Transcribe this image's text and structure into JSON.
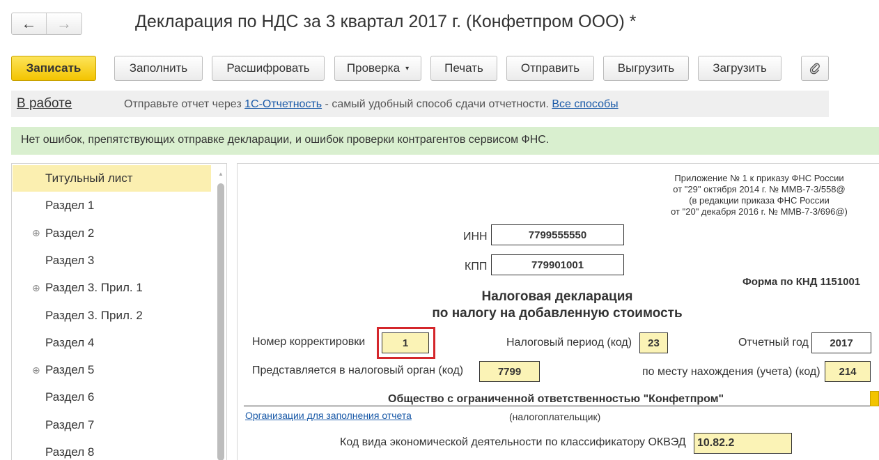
{
  "nav": {
    "back_icon": "←",
    "forward_icon": "→"
  },
  "window": {
    "title": "Декларация по НДС за 3 квартал 2017 г. (Конфетпром ООО) *"
  },
  "toolbar": {
    "save": "Записать",
    "fill": "Заполнить",
    "decode": "Расшифровать",
    "check": "Проверка",
    "check_caret": "▾",
    "print": "Печать",
    "send": "Отправить",
    "export": "Выгрузить",
    "import": "Загрузить",
    "attach_icon": "📎"
  },
  "status": {
    "state_link": "В работе",
    "message_prefix": "Отправьте отчет через ",
    "service_link": "1С-Отчетность",
    "message_suffix": " - самый удобный способ сдачи отчетности. ",
    "all_methods_link": "Все способы"
  },
  "info": {
    "message": "Нет ошибок, препятствующих отправке декларации, и ошибок проверки контрагентов сервисом ФНС."
  },
  "sections": {
    "selected_index": 0,
    "items": [
      {
        "label": "Титульный лист",
        "expand": ""
      },
      {
        "label": "Раздел 1",
        "expand": ""
      },
      {
        "label": "Раздел 2",
        "expand": "⊕"
      },
      {
        "label": "Раздел 3",
        "expand": ""
      },
      {
        "label": "Раздел 3. Прил. 1",
        "expand": "⊕"
      },
      {
        "label": "Раздел 3. Прил. 2",
        "expand": ""
      },
      {
        "label": "Раздел 4",
        "expand": ""
      },
      {
        "label": "Раздел 5",
        "expand": "⊕"
      },
      {
        "label": "Раздел 6",
        "expand": ""
      },
      {
        "label": "Раздел 7",
        "expand": ""
      },
      {
        "label": "Раздел 8",
        "expand": ""
      }
    ]
  },
  "form": {
    "appendix": [
      "Приложение № 1 к приказу ФНС России",
      "от \"29\" октября 2014 г. № ММВ-7-3/558@",
      "(в редакции приказа ФНС России",
      "от \"20\" декабря 2016 г. № ММВ-7-3/696@)"
    ],
    "inn_label": "ИНН",
    "inn_value": "7799555550",
    "kpp_label": "КПП",
    "kpp_value": "779901001",
    "knd": "Форма по КНД 1151001",
    "heading_line1": "Налоговая декларация",
    "heading_line2": "по налогу на добавленную стоимость",
    "correction_label": "Номер корректировки",
    "correction_value": "1",
    "period_label": "Налоговый период (код)",
    "period_value": "23",
    "year_label": "Отчетный год",
    "year_value": "2017",
    "authority_label": "Представляется в налоговый орган (код)",
    "authority_value": "7799",
    "location_label": "по месту нахождения (учета) (код)",
    "location_value": "214",
    "org_name": "Общество с ограниченной ответственностью \"Конфетпром\"",
    "org_link": "Организации для заполнения отчета",
    "taxpayer_label": "(налогоплательщик)",
    "okved_label": "Код вида экономической деятельности по классификатору ОКВЭД",
    "okved_value": "10.82.2"
  },
  "colors": {
    "accent_yellow": "#f3c400",
    "info_green": "#d9efcf",
    "selected_row": "#fbefb0",
    "field_yellow": "#fbf3b6",
    "highlight_red": "#d4262b",
    "link_blue": "#1a5aa8"
  }
}
